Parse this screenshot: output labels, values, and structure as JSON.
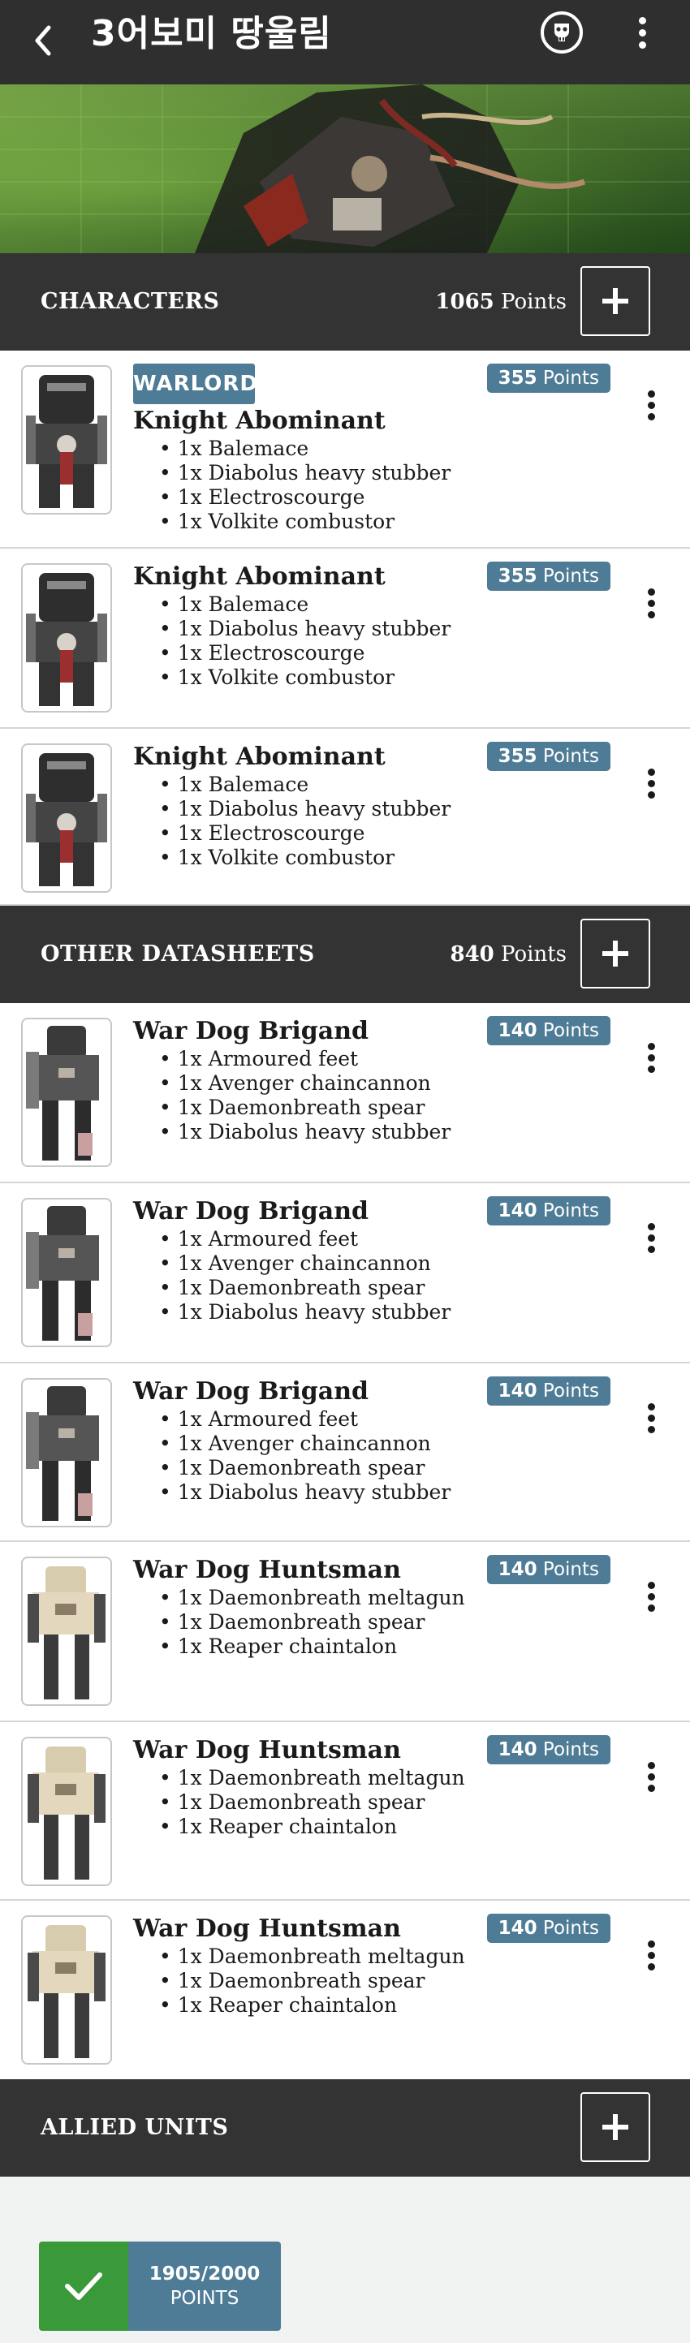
{
  "header": {
    "back_icon": "back-arrow-icon",
    "title": "3어보미 땅울림",
    "faction_icon": "faction-skull-icon",
    "menu_icon": "kebab-menu-icon"
  },
  "points_suffix": "Points",
  "sections": {
    "characters": {
      "title": "CHARACTERS",
      "points_value": "1065",
      "points_label": "Points"
    },
    "other": {
      "title": "OTHER DATASHEETS",
      "points_value": "840",
      "points_label": "Points"
    },
    "allied": {
      "title": "ALLIED UNITS"
    }
  },
  "warlord_label": "WARLORD",
  "characters": [
    {
      "name": "Knight Abominant",
      "points": "355",
      "warlord": true,
      "wargear": [
        "1x Balemace",
        "1x Diabolus heavy stubber",
        "1x Electroscourge",
        "1x Volkite combustor"
      ]
    },
    {
      "name": "Knight Abominant",
      "points": "355",
      "warlord": false,
      "wargear": [
        "1x Balemace",
        "1x Diabolus heavy stubber",
        "1x Electroscourge",
        "1x Volkite combustor"
      ]
    },
    {
      "name": "Knight Abominant",
      "points": "355",
      "warlord": false,
      "wargear": [
        "1x Balemace",
        "1x Diabolus heavy stubber",
        "1x Electroscourge",
        "1x Volkite combustor"
      ]
    }
  ],
  "other": [
    {
      "name": "War Dog Brigand",
      "points": "140",
      "wargear": [
        "1x Armoured feet",
        "1x Avenger chaincannon",
        "1x Daemonbreath spear",
        "1x Diabolus heavy stubber"
      ]
    },
    {
      "name": "War Dog Brigand",
      "points": "140",
      "wargear": [
        "1x Armoured feet",
        "1x Avenger chaincannon",
        "1x Daemonbreath spear",
        "1x Diabolus heavy stubber"
      ]
    },
    {
      "name": "War Dog Brigand",
      "points": "140",
      "wargear": [
        "1x Armoured feet",
        "1x Avenger chaincannon",
        "1x Daemonbreath spear",
        "1x Diabolus heavy stubber"
      ]
    },
    {
      "name": "War Dog Huntsman",
      "points": "140",
      "wargear": [
        "1x Daemonbreath meltagun",
        "1x Daemonbreath spear",
        "1x Reaper chaintalon"
      ]
    },
    {
      "name": "War Dog Huntsman",
      "points": "140",
      "wargear": [
        "1x Daemonbreath meltagun",
        "1x Daemonbreath spear",
        "1x Reaper chaintalon"
      ]
    },
    {
      "name": "War Dog Huntsman",
      "points": "140",
      "wargear": [
        "1x Daemonbreath meltagun",
        "1x Daemonbreath spear",
        "1x Reaper chaintalon"
      ]
    }
  ],
  "footer": {
    "total": "1905/2000",
    "label": "POINTS",
    "status_icon": "checkmark-icon"
  },
  "colors": {
    "header_bg": "#2f2f2f",
    "section_bg": "#333333",
    "accent": "#4e7b95",
    "valid": "#3a9a3a",
    "page_bg": "#f1f2f2"
  }
}
